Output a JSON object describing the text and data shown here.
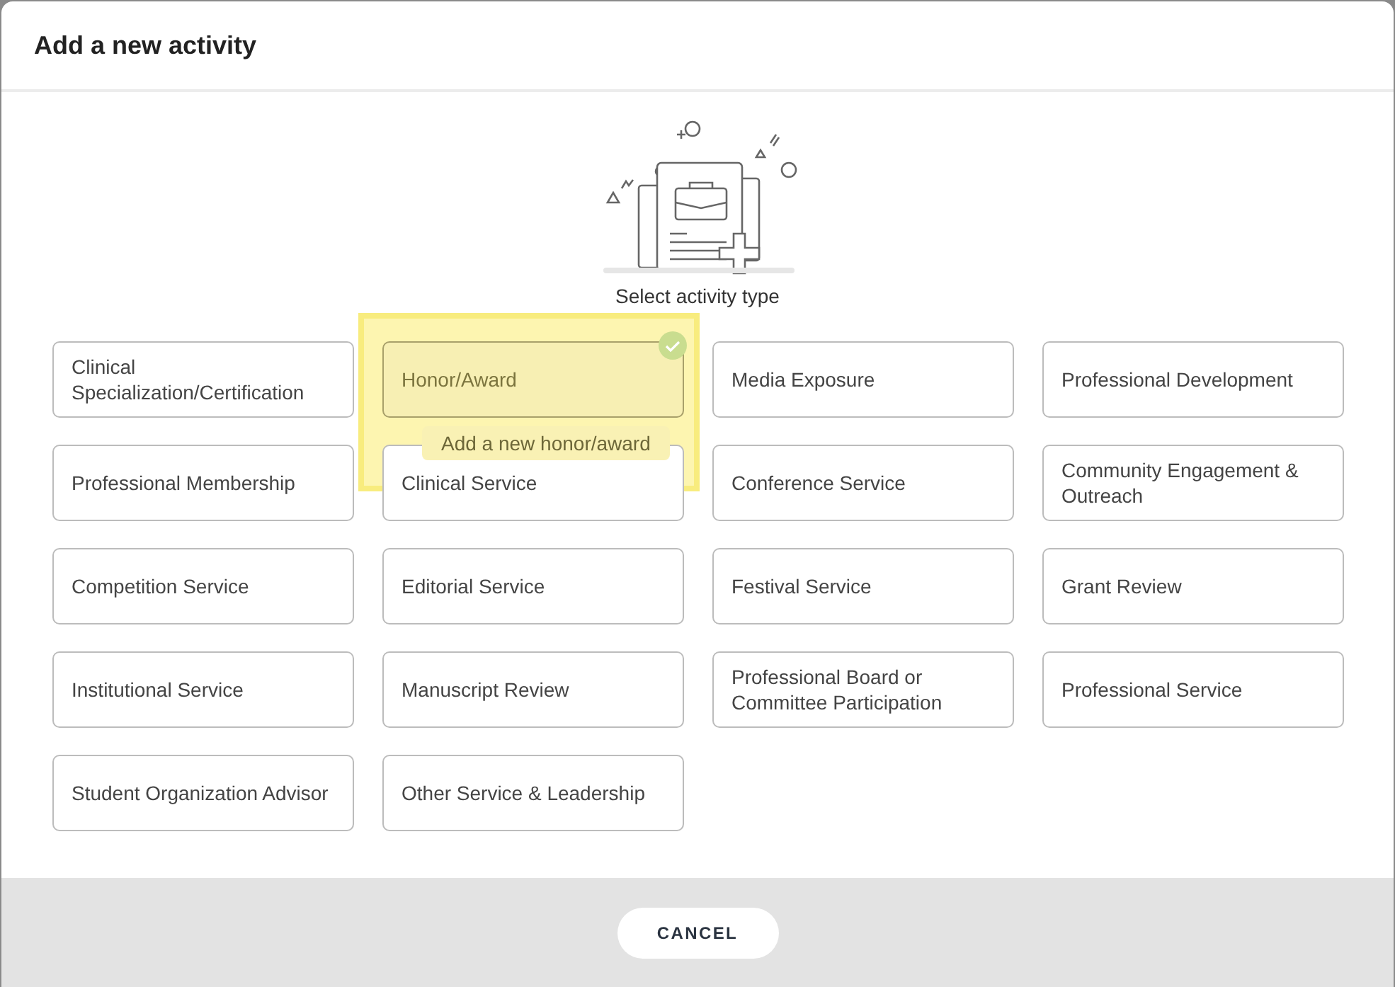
{
  "dialog": {
    "title": "Add a new activity",
    "prompt": "Select activity type"
  },
  "activity_types": [
    {
      "label": "Clinical Specialization/Certification",
      "selected": false
    },
    {
      "label": "Honor/Award",
      "selected": true
    },
    {
      "label": "Media Exposure",
      "selected": false
    },
    {
      "label": "Professional Development",
      "selected": false
    },
    {
      "label": "Professional Membership",
      "selected": false
    },
    {
      "label": "Clinical Service",
      "selected": false
    },
    {
      "label": "Conference Service",
      "selected": false
    },
    {
      "label": "Community Engagement & Outreach",
      "selected": false
    },
    {
      "label": "Competition Service",
      "selected": false
    },
    {
      "label": "Editorial Service",
      "selected": false
    },
    {
      "label": "Festival Service",
      "selected": false
    },
    {
      "label": "Grant Review",
      "selected": false
    },
    {
      "label": "Institutional Service",
      "selected": false
    },
    {
      "label": "Manuscript Review",
      "selected": false
    },
    {
      "label": "Professional Board or Committee Participation",
      "selected": false
    },
    {
      "label": "Professional Service",
      "selected": false
    },
    {
      "label": "Student Organization Advisor",
      "selected": false
    },
    {
      "label": "Other Service & Leadership",
      "selected": false
    }
  ],
  "tooltip": "Add a new honor/award",
  "buttons": [
    "CANCEL"
  ]
}
